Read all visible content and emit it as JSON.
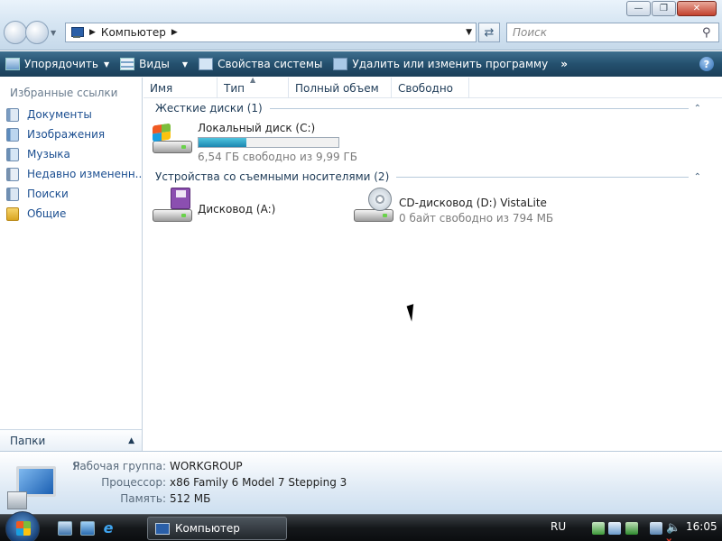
{
  "address": {
    "crumb": "Компьютер"
  },
  "search": {
    "placeholder": "Поиск"
  },
  "toolbar": {
    "organize": "Упорядочить",
    "views": "Виды",
    "system_properties": "Свойства системы",
    "uninstall": "Удалить или изменить программу",
    "more": "»",
    "help": "?"
  },
  "nav": {
    "favorites_title": "Избранные ссылки",
    "items": [
      {
        "label": "Документы",
        "icon": "documents-icon"
      },
      {
        "label": "Изображения",
        "icon": "pictures-icon"
      },
      {
        "label": "Музыка",
        "icon": "music-icon"
      },
      {
        "label": "Недавно измененн...",
        "icon": "recently-changed-icon"
      },
      {
        "label": "Поиски",
        "icon": "searches-icon"
      },
      {
        "label": "Общие",
        "icon": "public-folder-icon"
      }
    ],
    "folders": "Папки"
  },
  "columns": [
    "Имя",
    "Тип",
    "Полный объем",
    "Свободно"
  ],
  "groups": {
    "hard_disks": "Жесткие диски (1)",
    "removable": "Устройства со съемными носителями (2)"
  },
  "drives": {
    "c": {
      "name": "Локальный диск (C:)",
      "free": "6,54 ГБ свободно из 9,99 ГБ",
      "used_fraction": 0.345
    },
    "a": {
      "name": "Дисковод (A:)"
    },
    "d": {
      "name": "CD-дисковод (D:) VistaLite",
      "free": "0 байт свободно из 794 МБ"
    }
  },
  "details": {
    "name": "Я",
    "workgroup_label": "Рабочая группа:",
    "workgroup": "WORKGROUP",
    "processor_label": "Процессор:",
    "processor": "x86 Family 6 Model 7 Stepping 3",
    "memory_label": "Память:",
    "memory": "512 МБ"
  },
  "taskbar": {
    "task": "Компьютер",
    "lang": "RU",
    "clock": "16:05"
  },
  "colors": {
    "command_bar": "#24506e",
    "link": "#1c4f91",
    "capacity_fill": "#1b86b0"
  }
}
